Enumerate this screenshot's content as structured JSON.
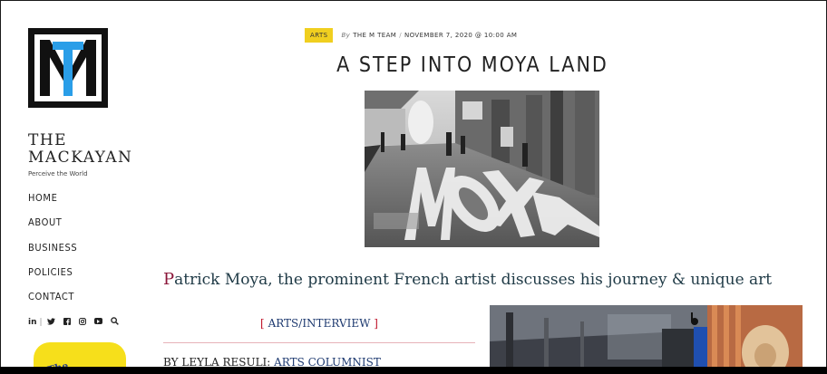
{
  "site": {
    "logo_letters": "MT",
    "title": "THE MACKAYAN",
    "tagline": "Perceive the World"
  },
  "nav": {
    "items": [
      "HOME",
      "ABOUT",
      "BUSINESS",
      "POLICIES",
      "CONTACT"
    ]
  },
  "social": {
    "icons": [
      "linkedin-icon",
      "twitter-icon",
      "facebook-icon",
      "instagram-icon",
      "youtube-icon",
      "search-icon"
    ],
    "linkedin_label": "in",
    "twitter_glyph": "🐦",
    "facebook_label": "f",
    "instagram_glyph": "◎",
    "search_glyph": "⌕"
  },
  "banner": {
    "text": "The Mackayan"
  },
  "post": {
    "category": "ARTS",
    "by": "By",
    "author": "THE M TEAM",
    "date": "NOVEMBER 7, 2020 @ 10:00 AM",
    "title": "A STEP INTO MOYA LAND",
    "lead_drop": "P",
    "lead_rest": "atrick Moya, the prominent French artist discusses his journey & unique art",
    "section_label": "ARTS/INTERVIEW",
    "section_open": "[",
    "section_close": "]",
    "byline_prefix": "BY LEYLA RESULI: ",
    "byline_role": "ARTS COLUMNIST"
  },
  "colors": {
    "badge": "#f0cf1f",
    "lead_text": "#1f3a46",
    "drop_cap": "#8a1538",
    "link_blue": "#1e3a70",
    "bracket_red": "#c0152b",
    "logo_blue": "#2a9ee8"
  }
}
